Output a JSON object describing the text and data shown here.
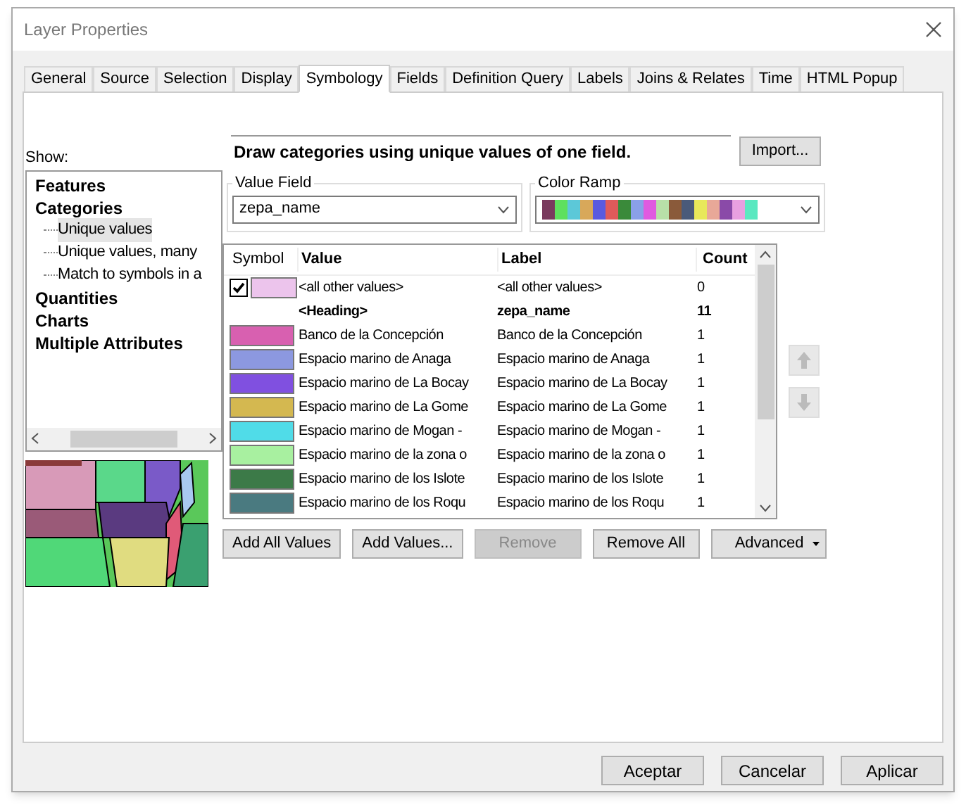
{
  "window": {
    "title": "Layer Properties"
  },
  "tabs": [
    {
      "label": "General",
      "selected": false
    },
    {
      "label": "Source",
      "selected": false
    },
    {
      "label": "Selection",
      "selected": false
    },
    {
      "label": "Display",
      "selected": false
    },
    {
      "label": "Symbology",
      "selected": true
    },
    {
      "label": "Fields",
      "selected": false
    },
    {
      "label": "Definition Query",
      "selected": false
    },
    {
      "label": "Labels",
      "selected": false
    },
    {
      "label": "Joins & Relates",
      "selected": false
    },
    {
      "label": "Time",
      "selected": false
    },
    {
      "label": "HTML Popup",
      "selected": false
    }
  ],
  "show": {
    "label": "Show:",
    "items": [
      {
        "label": "Features",
        "selected": false
      },
      {
        "label": "Categories",
        "selected": false,
        "children": [
          {
            "label": "Unique values",
            "selected": true
          },
          {
            "label": "Unique values, many",
            "selected": false
          },
          {
            "label": "Match to symbols in a",
            "selected": false
          }
        ]
      },
      {
        "label": "Quantities",
        "selected": false
      },
      {
        "label": "Charts",
        "selected": false
      },
      {
        "label": "Multiple Attributes",
        "selected": false
      }
    ]
  },
  "description": "Draw categories using unique values of one field.",
  "import_button": "Import...",
  "value_field": {
    "label": "Value Field",
    "value": "zepa_name"
  },
  "color_ramp": {
    "label": "Color Ramp",
    "swatches": [
      {
        "color": "#7a3a5e"
      },
      {
        "color": "#5ee05e"
      },
      {
        "color": "#5cc8d8"
      },
      {
        "color": "#d8a85a"
      },
      {
        "color": "#5a5ae0"
      },
      {
        "color": "#e05a5a"
      },
      {
        "color": "#3a8a3a"
      },
      {
        "color": "#8aa0e8"
      },
      {
        "color": "#e05ae0"
      },
      {
        "color": "#b8e0a8"
      },
      {
        "color": "#8a5a3a"
      },
      {
        "color": "#4a5a7a"
      },
      {
        "color": "#e8e85a"
      },
      {
        "color": "#e8a898"
      },
      {
        "color": "#8a4aa8"
      },
      {
        "color": "#e8a0e0"
      },
      {
        "color": "#5ae8c0"
      }
    ]
  },
  "table": {
    "columns": [
      "Symbol",
      "Value",
      "Label",
      "Count"
    ],
    "rows": [
      {
        "kind": "other",
        "checked": true,
        "color": "#ecc4ec",
        "value": "<all other values>",
        "label": "<all other values>",
        "count": "0"
      },
      {
        "kind": "heading",
        "value": "<Heading>",
        "label": "zepa_name",
        "count": "11"
      },
      {
        "kind": "class",
        "color": "#d860b0",
        "value": "Banco de la Concepción",
        "label": "Banco de la Concepción",
        "count": "1"
      },
      {
        "kind": "class",
        "color": "#8c98e0",
        "value": "Espacio marino de Anaga",
        "label": "Espacio marino de Anaga",
        "count": "1"
      },
      {
        "kind": "class",
        "color": "#8050e0",
        "value": "Espacio marino de La Bocay",
        "label": "Espacio marino de La Bocay",
        "count": "1"
      },
      {
        "kind": "class",
        "color": "#d4b850",
        "value": "Espacio marino de La Gome",
        "label": "Espacio marino de La Gome",
        "count": "1"
      },
      {
        "kind": "class",
        "color": "#50dce8",
        "value": "Espacio marino de Mogan -",
        "label": "Espacio marino de Mogan -",
        "count": "1"
      },
      {
        "kind": "class",
        "color": "#a8f0a0",
        "value": "Espacio marino de la zona o",
        "label": "Espacio marino de la zona o",
        "count": "1"
      },
      {
        "kind": "class",
        "color": "#3c7a48",
        "value": "Espacio marino de los Islote",
        "label": "Espacio marino de los Islote",
        "count": "1"
      },
      {
        "kind": "class",
        "color": "#4a7a80",
        "value": "Espacio marino de los Roqu",
        "label": "Espacio marino de los Roqu",
        "count": "1"
      }
    ]
  },
  "table_buttons": [
    {
      "label": "Add All Values",
      "disabled": false
    },
    {
      "label": "Add Values...",
      "disabled": false
    },
    {
      "label": "Remove",
      "disabled": true
    },
    {
      "label": "Remove All",
      "disabled": false
    }
  ],
  "advanced_button": "Advanced",
  "dialog_buttons": [
    "Aceptar",
    "Cancelar",
    "Aplicar"
  ]
}
